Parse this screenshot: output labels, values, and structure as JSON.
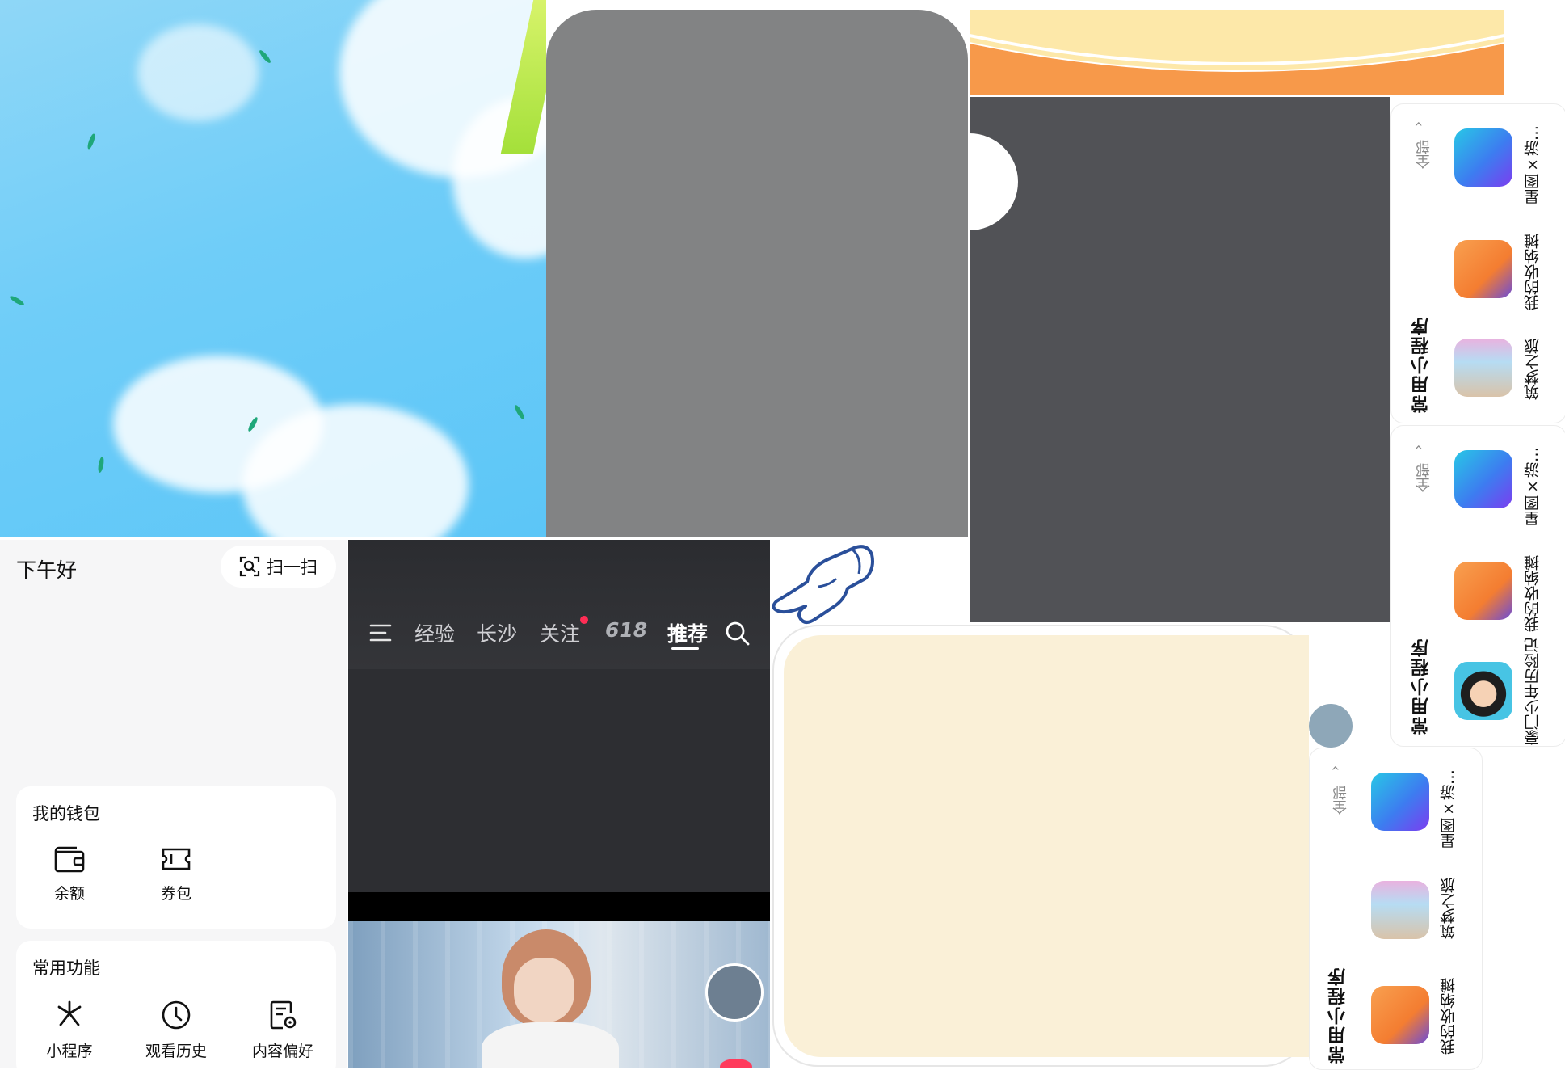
{
  "me_panel": {
    "greeting": "下午好",
    "scan_label": "扫一扫",
    "wallet": {
      "title": "我的钱包",
      "items": [
        {
          "label": "余额",
          "icon": "wallet-icon"
        },
        {
          "label": "券包",
          "icon": "coupon-icon"
        }
      ]
    },
    "functions": {
      "title": "常用功能",
      "items": [
        {
          "label": "小程序",
          "icon": "mini-program-icon"
        },
        {
          "label": "观看历史",
          "icon": "clock-icon"
        },
        {
          "label": "内容偏好",
          "icon": "preference-icon"
        }
      ]
    }
  },
  "feed_panel": {
    "tabs": [
      "经验",
      "长沙",
      "关注",
      "618",
      "推荐"
    ],
    "active_tab": "推荐"
  },
  "mini_program_cards": [
    {
      "title": "常用小程序",
      "all_label": "全部",
      "apps": [
        "星图×游…",
        "我的收纳摊",
        "筑梦之旅"
      ]
    },
    {
      "title": "常用小程序",
      "all_label": "全部",
      "apps": [
        "星图×游…",
        "我的收纳摊",
        "豪门少年历险记"
      ]
    },
    {
      "title": "常用小程序",
      "all_label": "全部",
      "apps": [
        "星图×游…",
        "筑梦之旅",
        "我的收纳摊"
      ]
    }
  ],
  "colors": {
    "sky": "#6fcdf8",
    "gray_card": "#828384",
    "dark_panel": "#515256",
    "feed_bg": "#2d2e32",
    "beige": "#faf0d7",
    "slate_dot": "#8ea7b8",
    "orange_banner": "#f7994a",
    "badge_red": "#ff2d55"
  }
}
